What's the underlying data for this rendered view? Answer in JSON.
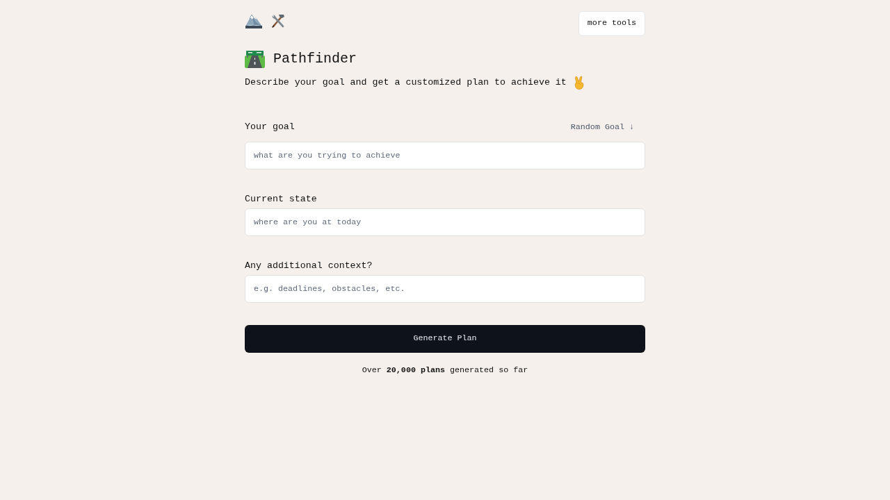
{
  "header": {
    "more_tools_button": "more tools"
  },
  "title": "Pathfinder",
  "subtitle": "Describe your goal and get a customized plan to achieve it",
  "fields": [
    {
      "label": "Your goal",
      "action": "Random Goal ↓",
      "placeholder": "what are you trying to achieve"
    },
    {
      "label": "Current state",
      "placeholder": "where are you at today"
    },
    {
      "label": "Any additional context?",
      "placeholder": "e.g. deadlines, obstacles, etc."
    }
  ],
  "submit_button": "Generate Plan",
  "footer": "Over **20,000 plans** generated so far"
}
